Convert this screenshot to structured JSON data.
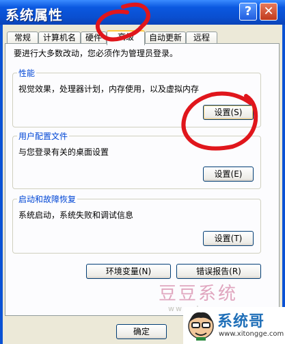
{
  "window": {
    "title": "系统属性",
    "help_label": "?",
    "close_label": "✕"
  },
  "tabs": [
    {
      "label": "常规"
    },
    {
      "label": "计算机名"
    },
    {
      "label": "硬件"
    },
    {
      "label": "高级",
      "active": true
    },
    {
      "label": "自动更新"
    },
    {
      "label": "远程"
    }
  ],
  "panel": {
    "note": "要进行大多数改动，您必须作为管理员登录。",
    "groups": [
      {
        "title": "性能",
        "description": "视觉效果，处理器计划，内存使用，以及虚拟内存",
        "button_label": "设置(S)"
      },
      {
        "title": "用户配置文件",
        "description": "与您登录有关的桌面设置",
        "button_label": "设置(E)"
      },
      {
        "title": "启动和故障恢复",
        "description": "系统启动，系统失败和调试信息",
        "button_label": "设置(T)"
      }
    ],
    "env_vars_label": "环境变量(N)",
    "error_report_label": "错误报告(R)"
  },
  "footer": {
    "ok_label": "确定"
  },
  "watermark": {
    "text": "豆豆系统",
    "url": "www.d"
  },
  "logo": {
    "name": "系统哥",
    "url": "www.xitongge.com"
  },
  "colors": {
    "titlebar": "#0a4fd0",
    "dialog_bg": "#ece9d8",
    "group_title": "#0046d5",
    "annotation_red": "#e0161c"
  }
}
